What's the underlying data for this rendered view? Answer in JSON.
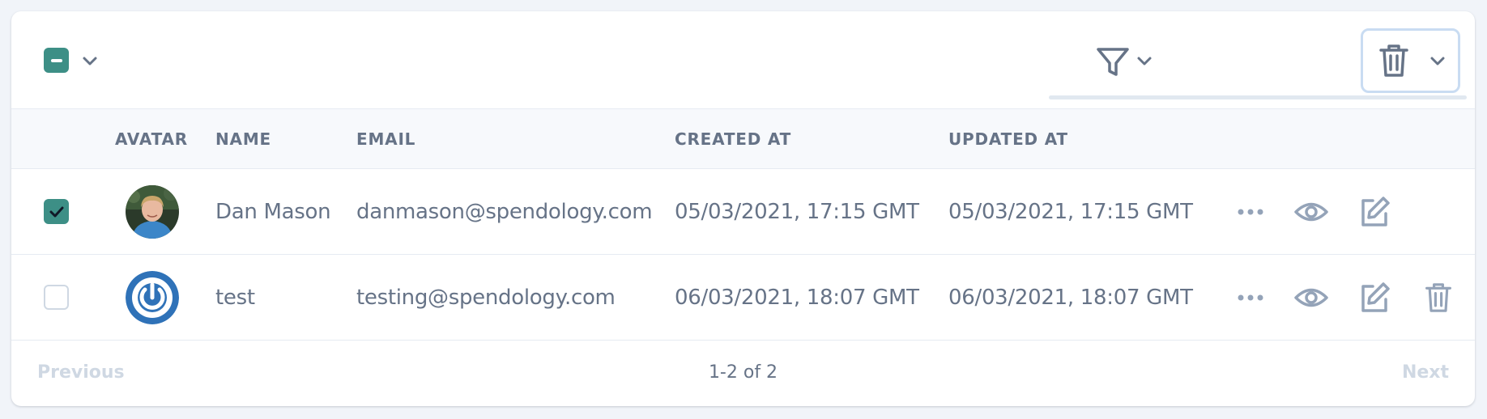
{
  "columns": {
    "avatar": "AVATAR",
    "name": "NAME",
    "email": "EMAIL",
    "created": "CREATED AT",
    "updated": "UPDATED AT"
  },
  "rows": [
    {
      "checked": true,
      "name": "Dan Mason",
      "email": "danmason@spendology.com",
      "created": "05/03/2021, 17:15 GMT",
      "updated": "05/03/2021, 17:15 GMT",
      "avatar": "photo-avatar",
      "actions": [
        "more-icon",
        "eye-icon",
        "edit-icon"
      ]
    },
    {
      "checked": false,
      "name": "test",
      "email": "testing@spendology.com",
      "created": "06/03/2021, 18:07 GMT",
      "updated": "06/03/2021, 18:07 GMT",
      "avatar": "power-icon-avatar",
      "actions": [
        "more-icon",
        "eye-icon",
        "edit-icon",
        "trash-icon"
      ]
    }
  ],
  "pagination": {
    "previous": "Previous",
    "count": "1-2 of 2",
    "next": "Next"
  },
  "colors": {
    "accent": "#3d8f86",
    "text": "#667387",
    "icon": "#94a3b8",
    "disabled": "#cfd8e3"
  }
}
